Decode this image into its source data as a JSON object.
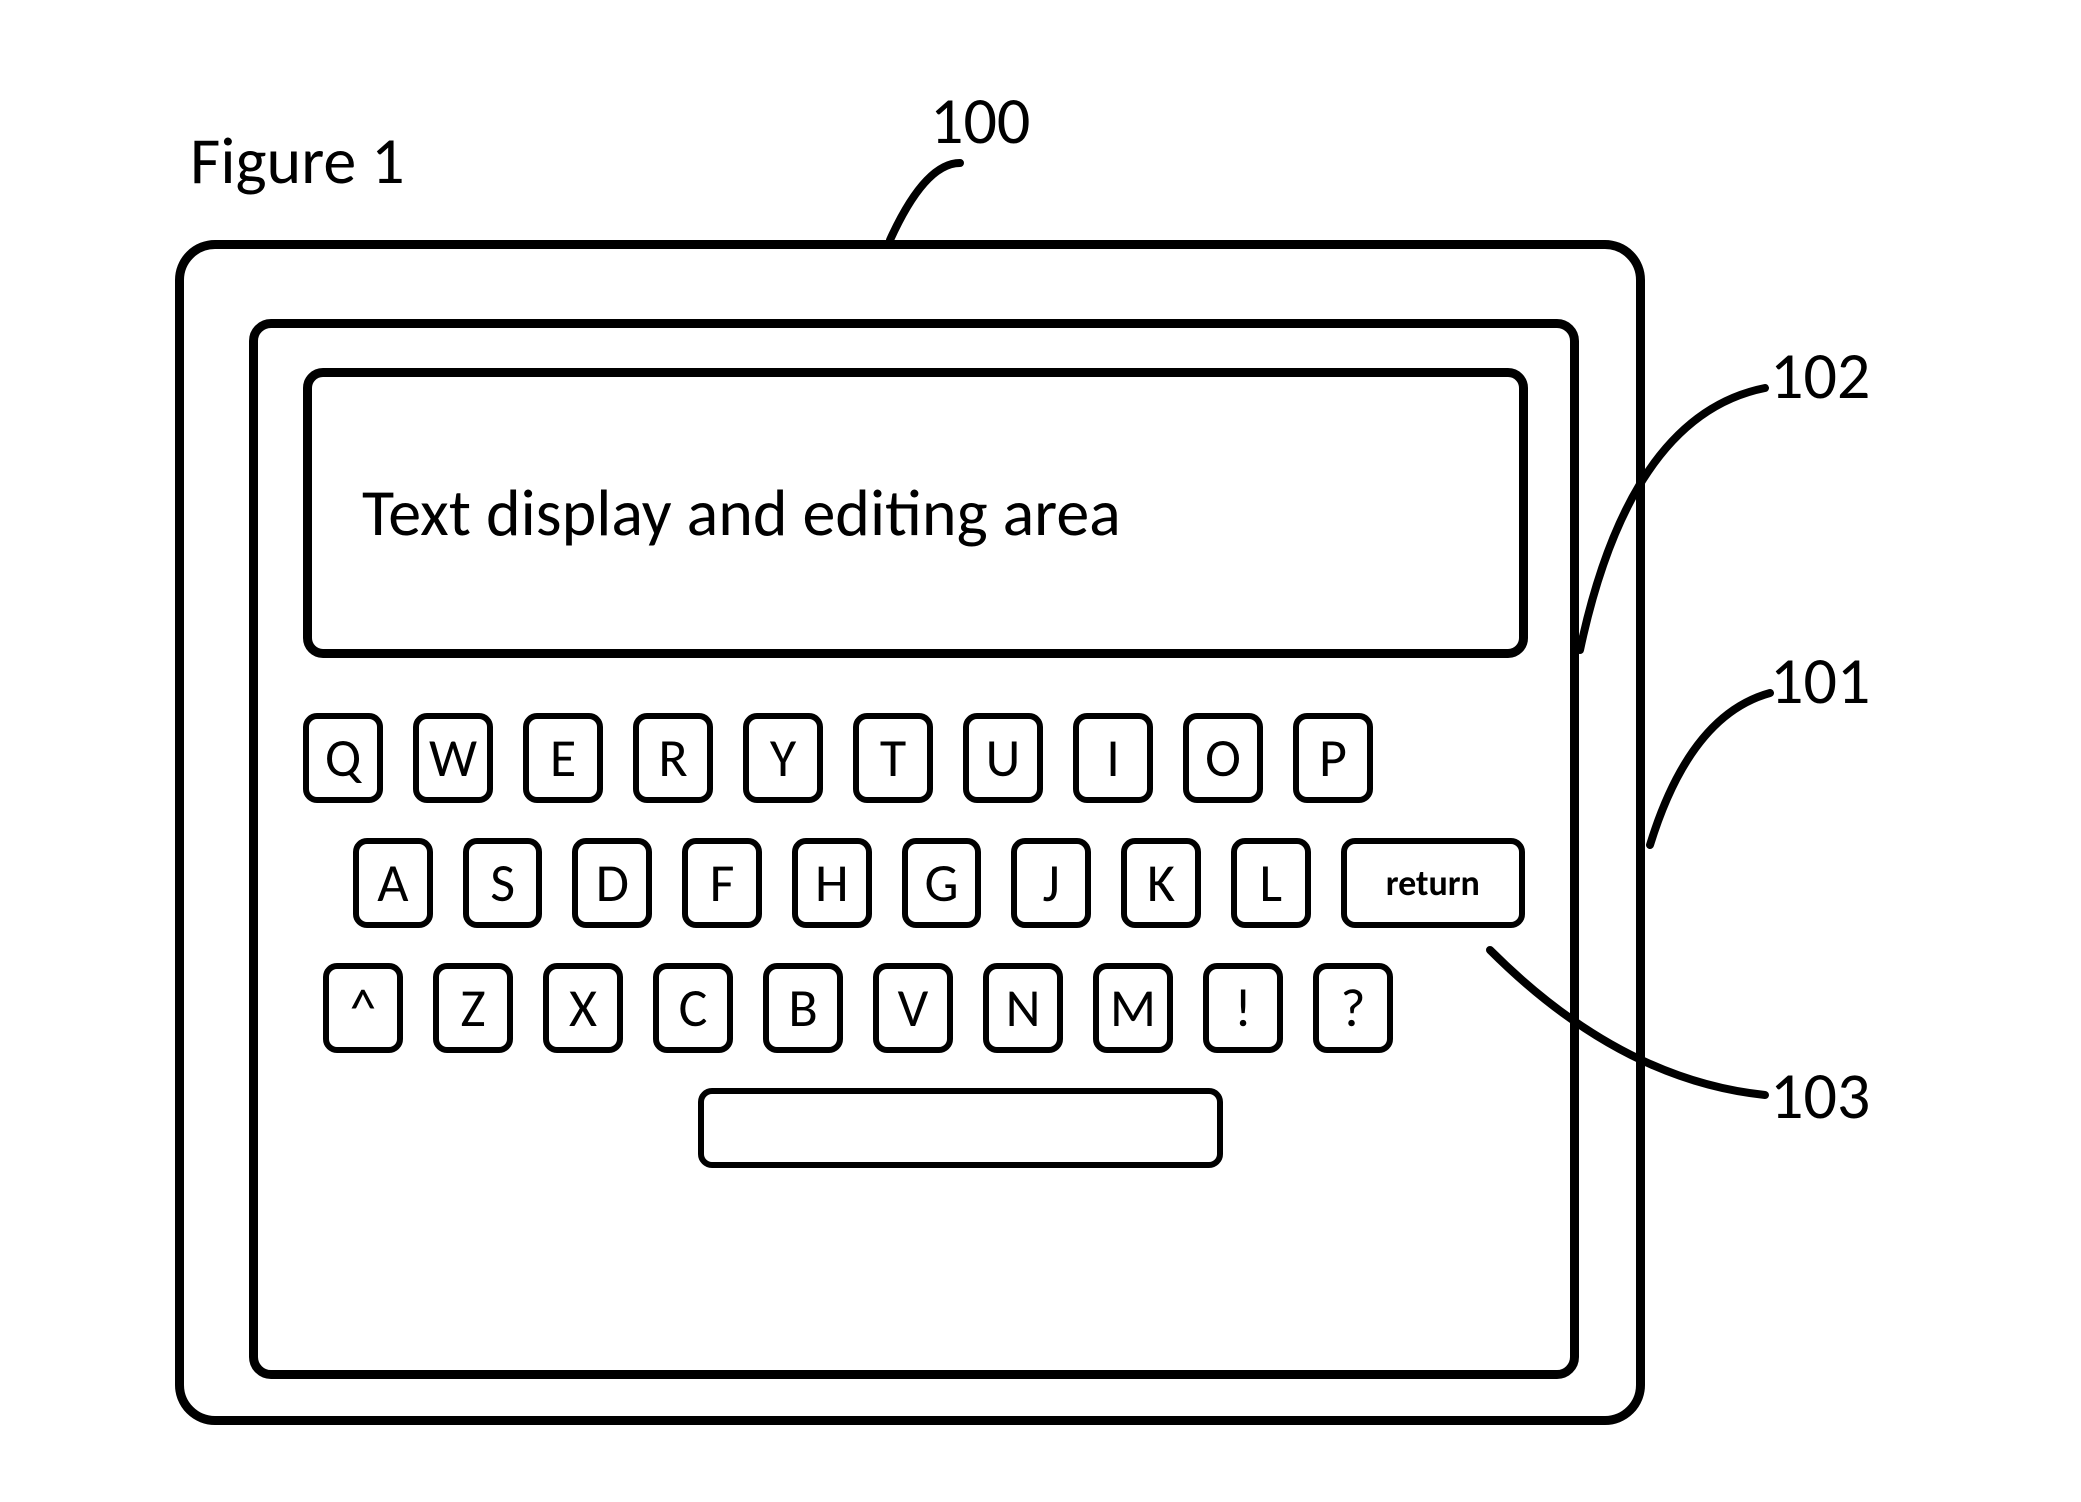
{
  "figure_title": "Figure 1",
  "text_area_label": "Text display and editing area",
  "rows": {
    "r1": [
      "Q",
      "W",
      "E",
      "R",
      "Y",
      "T",
      "U",
      "I",
      "O",
      "P"
    ],
    "r2": [
      "A",
      "S",
      "D",
      "F",
      "H",
      "G",
      "J",
      "K",
      "L"
    ],
    "r2_return": "return",
    "r3": [
      "^",
      "Z",
      "X",
      "C",
      "B",
      "V",
      "N",
      "M",
      "!",
      "?"
    ]
  },
  "refs": {
    "r100": "100",
    "r101": "101",
    "r102": "102",
    "r103": "103"
  }
}
